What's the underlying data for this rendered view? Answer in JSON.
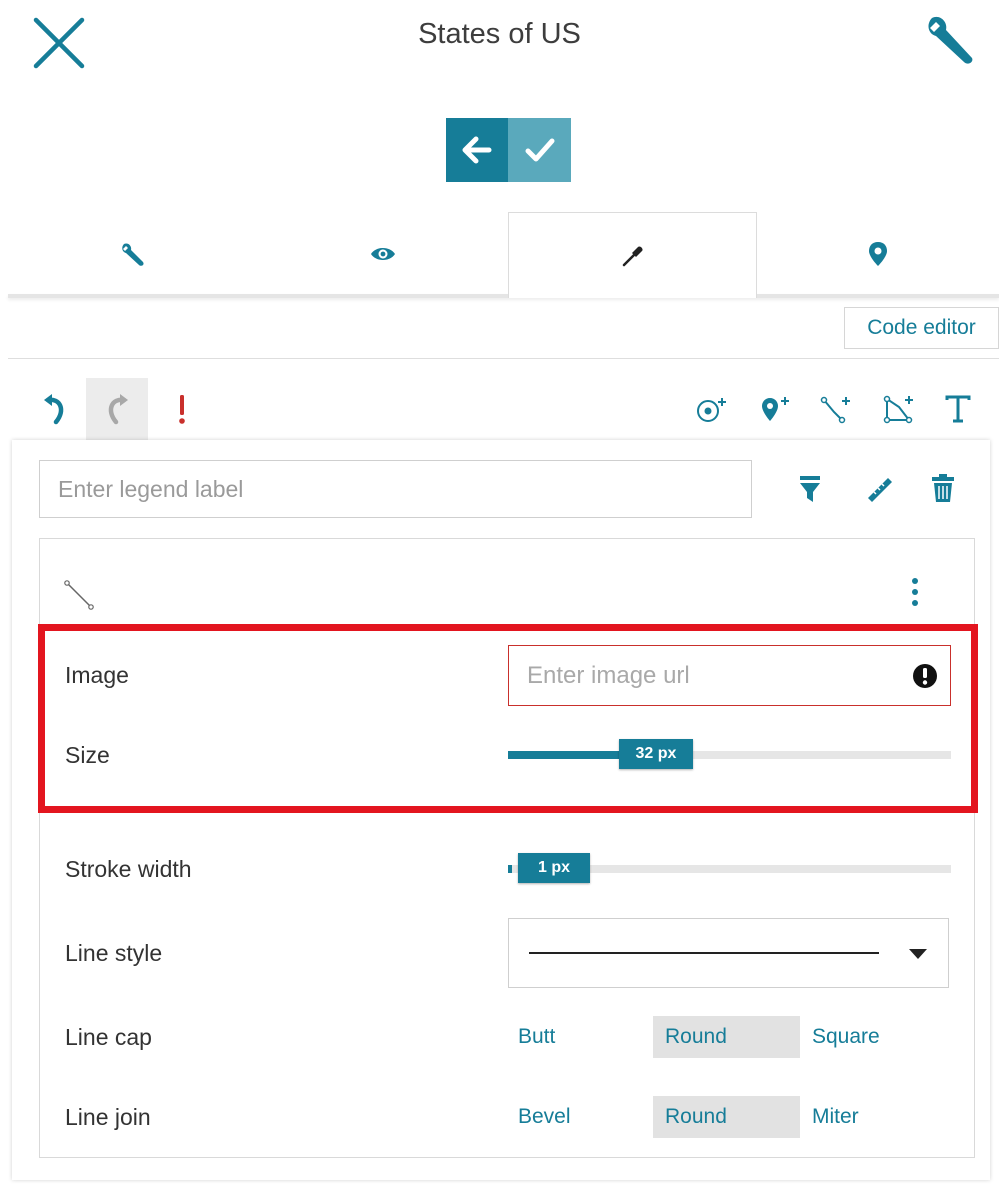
{
  "header": {
    "title": "States of US"
  },
  "tabs": [
    {
      "icon": "wrench-icon"
    },
    {
      "icon": "eye-icon"
    },
    {
      "icon": "eyedropper-icon",
      "active": true
    },
    {
      "icon": "map-pin-icon"
    }
  ],
  "code_editor_label": "Code editor",
  "legend": {
    "placeholder": "Enter legend label",
    "value": ""
  },
  "properties": {
    "image": {
      "label": "Image",
      "placeholder": "Enter image url",
      "value": "",
      "error": true
    },
    "size": {
      "label": "Size",
      "value_text": "32 px",
      "value": 32,
      "fill_fraction": 0.26
    },
    "stroke_width": {
      "label": "Stroke width",
      "value_text": "1 px",
      "value": 1,
      "fill_fraction": 0.01
    },
    "line_style": {
      "label": "Line style",
      "selected": "solid"
    },
    "line_cap": {
      "label": "Line cap",
      "options": [
        "Butt",
        "Round",
        "Square"
      ],
      "selected": "Round"
    },
    "line_join": {
      "label": "Line join",
      "options": [
        "Bevel",
        "Round",
        "Miter"
      ],
      "selected": "Round"
    }
  },
  "colors": {
    "accent": "#167d98",
    "accent_light": "#5aa9bc",
    "error": "#c9302c",
    "highlight": "#e3151f"
  }
}
